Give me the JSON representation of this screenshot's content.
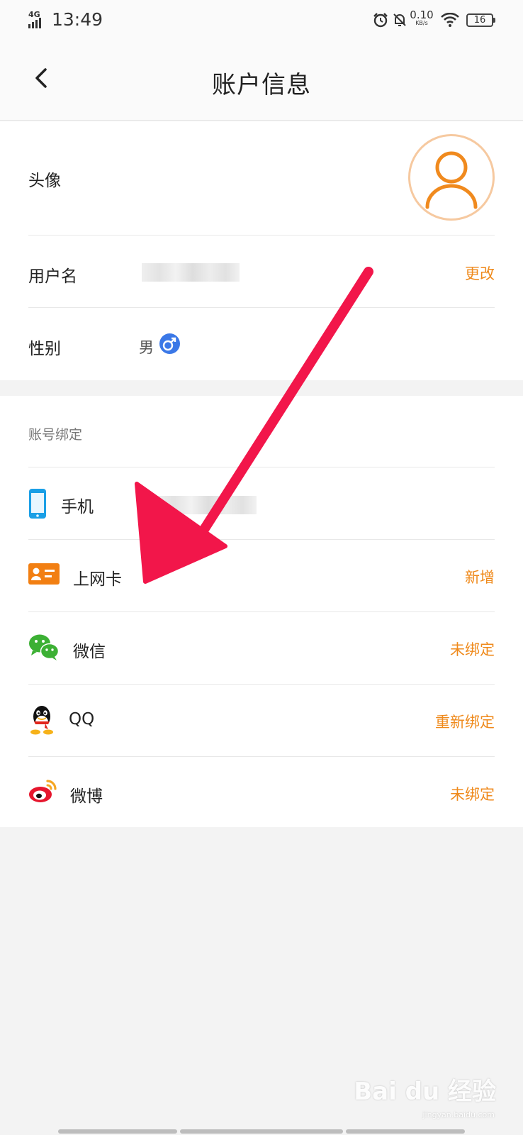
{
  "status_bar": {
    "network": "4G",
    "time": "13:49",
    "speed_value": "0.10",
    "speed_unit": "KB/s",
    "battery": "16"
  },
  "nav": {
    "title": "账户信息"
  },
  "profile": {
    "avatar_label": "头像",
    "username_label": "用户名",
    "username_action": "更改",
    "gender_label": "性别",
    "gender_value": "男",
    "gender_symbol": "♂"
  },
  "binding": {
    "section_title": "账号绑定",
    "items": [
      {
        "label": "手机",
        "action": "",
        "icon": "phone-icon"
      },
      {
        "label": "上网卡",
        "action": "新增",
        "icon": "card-icon"
      },
      {
        "label": "微信",
        "action": "未绑定",
        "icon": "wechat-icon"
      },
      {
        "label": "QQ",
        "action": "重新绑定",
        "icon": "qq-icon"
      },
      {
        "label": "微博",
        "action": "未绑定",
        "icon": "weibo-icon"
      }
    ]
  },
  "watermark": {
    "brand": "Bai du 经验",
    "url": "jingyan.baidu.com"
  },
  "colors": {
    "accent": "#ef8a1c",
    "arrow": "#f2164a",
    "gender": "#3b78e7"
  }
}
